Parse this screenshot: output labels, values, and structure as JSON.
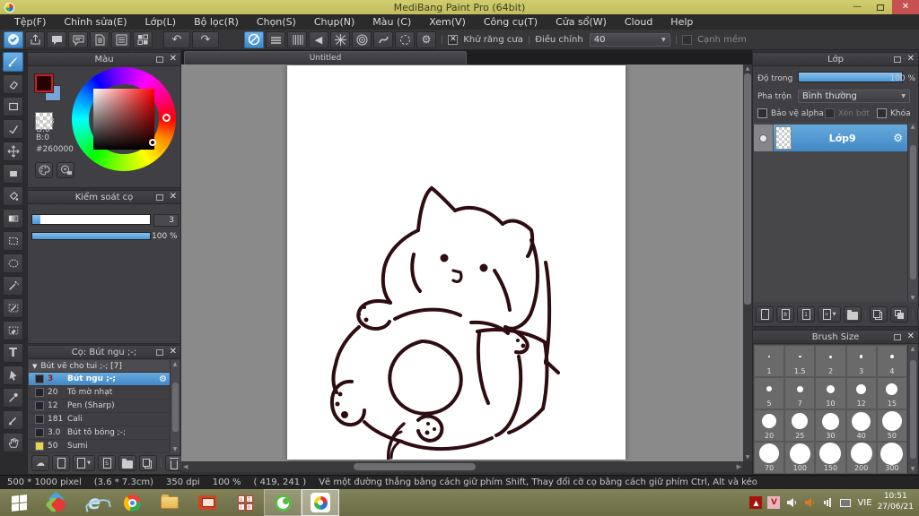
{
  "window": {
    "title": "MediBang Paint Pro (64bit)"
  },
  "menu": {
    "items": [
      "Tệp(F)",
      "Chỉnh sửa(E)",
      "Lớp(L)",
      "Bộ lọc(R)",
      "Chọn(S)",
      "Chụp(N)",
      "Màu (C)",
      "Xem(V)",
      "Công cụ(T)",
      "Cửa sổ(W)",
      "Cloud",
      "Help"
    ]
  },
  "toolbar": {
    "antialias_label": "Khử răng cưa",
    "correction_label": "Điều chỉnh",
    "correction_value": "40",
    "soft_edge_label": "Cạnh mềm"
  },
  "canvas": {
    "tab_title": "Untitled"
  },
  "color_panel": {
    "title": "Màu",
    "r": "R:38",
    "g": "G:0",
    "b": "B:0",
    "hex": "#260000",
    "foreground_color": "#260000",
    "background_color": "#7aa3d6"
  },
  "brush_control_panel": {
    "title": "Kiểm soát cọ",
    "size_value": "3",
    "opacity_value": "100 %"
  },
  "brush_panel": {
    "title": "Cọ: Bút ngu ;-;",
    "folder_label": "Bút vẽ cho tui ;-; [7]",
    "brushes": [
      {
        "size": "3",
        "name": "Bút ngu ;-;",
        "selected": true
      },
      {
        "size": "20",
        "name": "Tô mờ nhạt"
      },
      {
        "size": "12",
        "name": "Pen (Sharp)"
      },
      {
        "size": "181",
        "name": "Cali"
      },
      {
        "size": "3.0",
        "name": "Bút tô bóng ;-;"
      },
      {
        "size": "50",
        "name": "Sumi",
        "swatch": "#e8d44d"
      }
    ]
  },
  "layer_panel": {
    "title": "Lớp",
    "opacity_label": "Độ trong",
    "opacity_value": "100 %",
    "blend_label": "Pha trộn",
    "blend_value": "Bình thường",
    "alpha_label": "Bảo vệ alpha",
    "clip_label": "Xén bớt",
    "lock_label": "Khóa",
    "layers": [
      {
        "name": "Lớp9"
      }
    ]
  },
  "brush_size_panel": {
    "title": "Brush Size",
    "sizes": [
      "1",
      "1.5",
      "2",
      "3",
      "4",
      "5",
      "7",
      "10",
      "12",
      "15",
      "20",
      "25",
      "30",
      "40",
      "50",
      "70",
      "100",
      "150",
      "200",
      "300"
    ]
  },
  "statusbar": {
    "dimensions": "500 * 1000 pixel",
    "size_cm": "(3.6 * 7.3cm)",
    "dpi": "350 dpi",
    "zoom": "100 %",
    "cursor": "( 419, 241 )",
    "hint": "Vẽ một đường thẳng bằng cách giữ phím Shift, Thay đổi cỡ cọ bằng cách giữ phím Ctrl, Alt và kéo"
  },
  "taskbar": {
    "language": "VIE",
    "time": "10:51",
    "date": "27/06/21"
  },
  "colors": {
    "accent_blue": "#4f97d7",
    "titlebar_olive": "#c9c565",
    "selection_blue": "#57a1d8",
    "ink": "#2e0c12"
  }
}
